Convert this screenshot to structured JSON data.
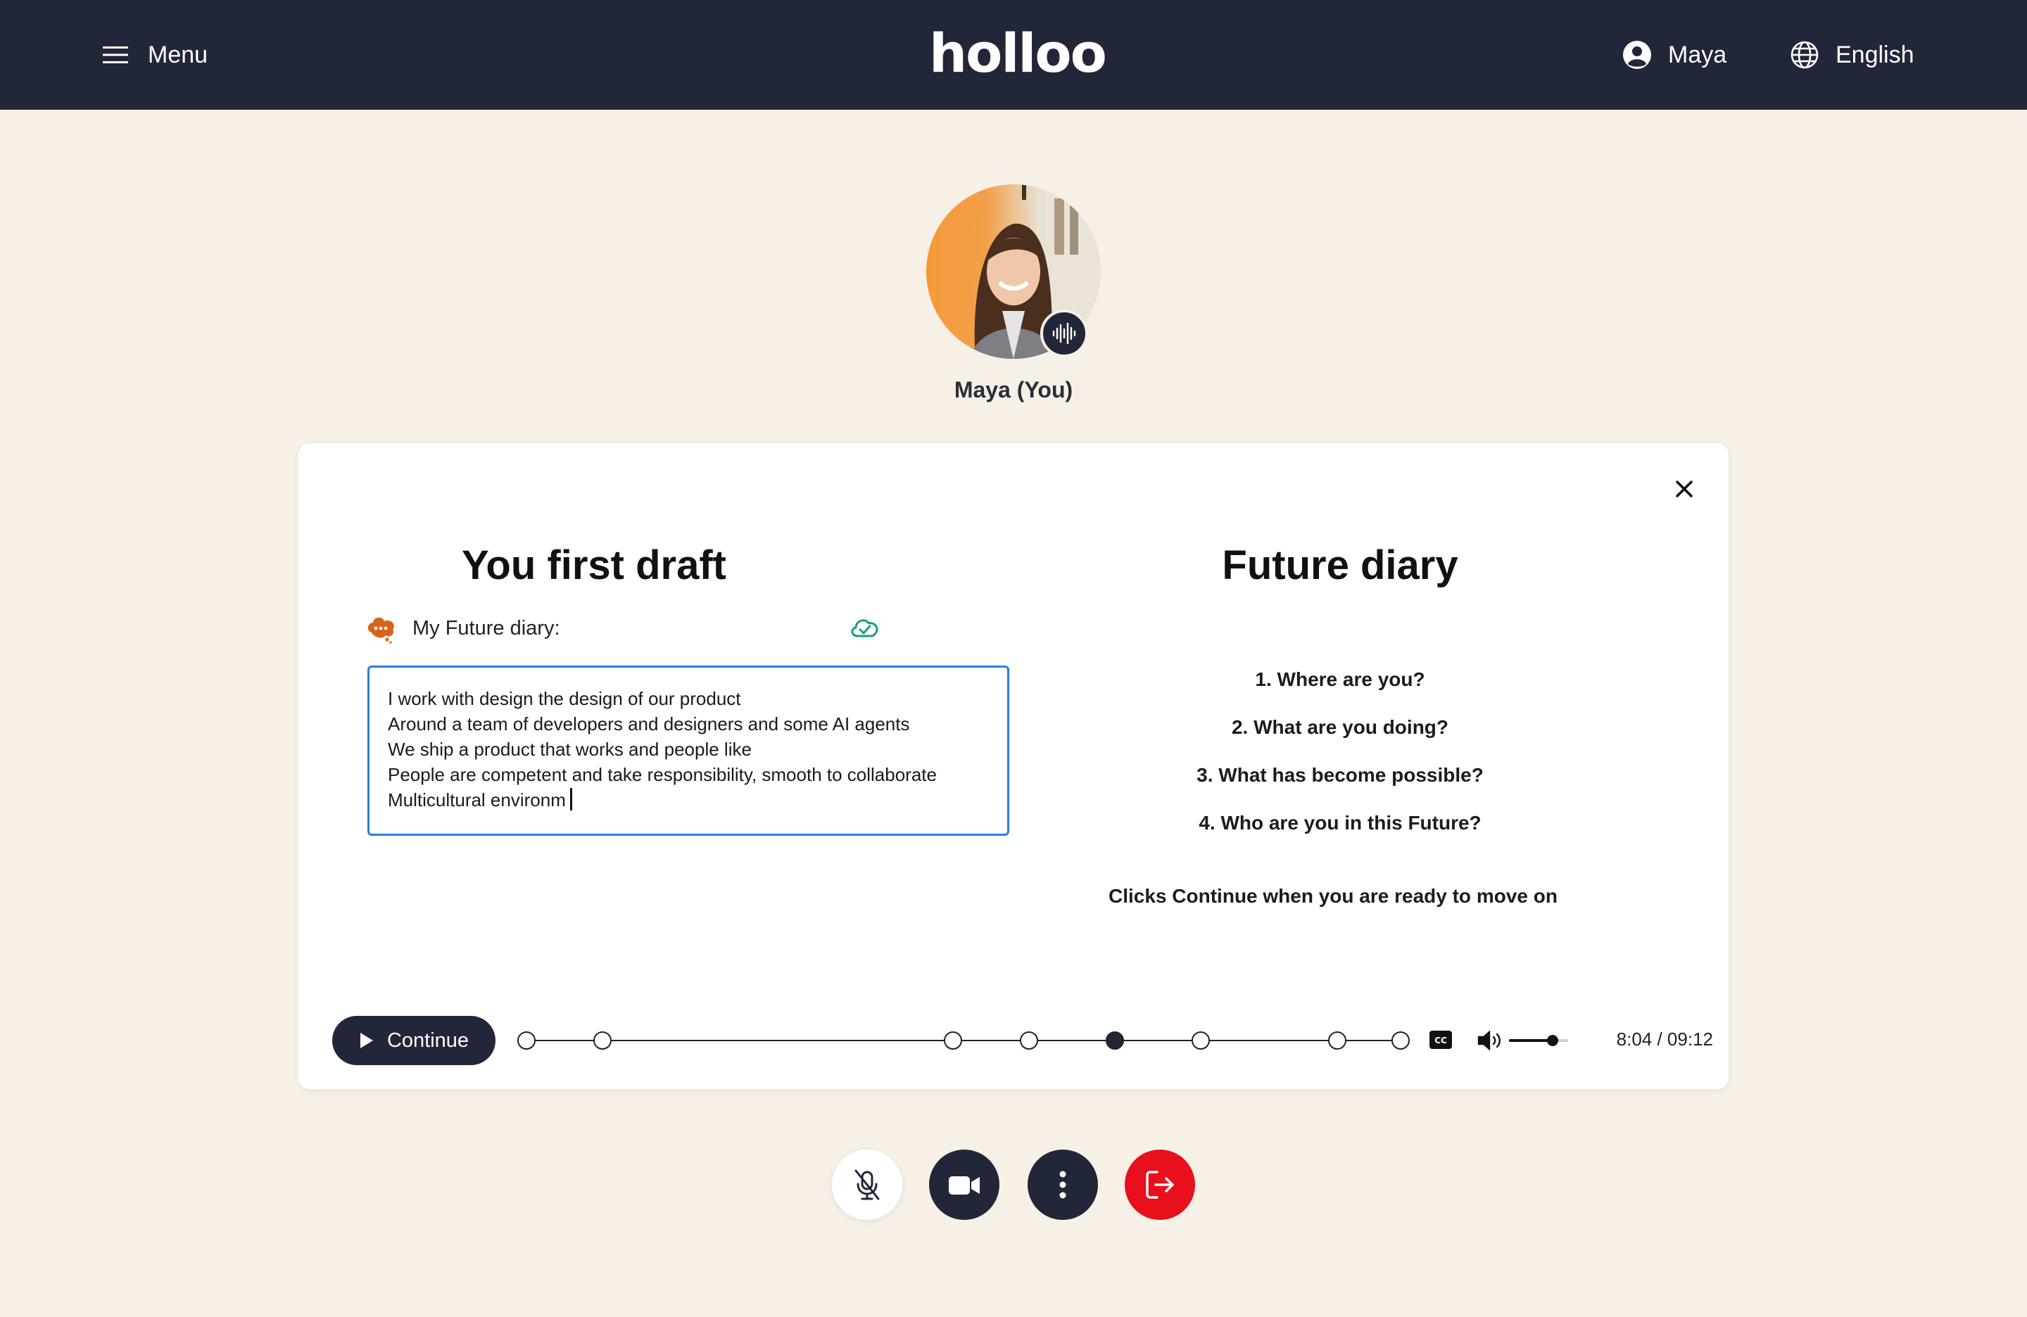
{
  "header": {
    "menu_label": "Menu",
    "logo": "holloo",
    "user_name": "Maya",
    "language": "English"
  },
  "participant": {
    "name": "Maya (You)"
  },
  "card": {
    "draft_title": "You first draft",
    "diary_label": "My Future diary:",
    "draft_lines": [
      "I work with design the design of our product",
      "Around a team of developers and designers and some AI agents",
      "We ship a product that works and people like",
      "People are competent and take responsibility, smooth to collaborate",
      "Multicultural environm"
    ],
    "diary_title": "Future diary",
    "questions": [
      "1. Where are you?",
      "2. What are you doing?",
      "3. What has become possible?",
      "4. Who are you in this Future?"
    ],
    "hint": "Clicks Continue when you are ready to move on"
  },
  "player": {
    "continue_label": "Continue",
    "time": "8:04 / 09:12",
    "progress_fraction": 0.674,
    "volume_fraction": 0.75,
    "active_marker_index": 4,
    "marker_count": 9
  },
  "colors": {
    "topbar": "#212739",
    "background": "#f7f0e6",
    "accent_blue": "#2f7ed8",
    "leave_red": "#e8101c",
    "saved_green": "#1a9e7a",
    "bubble_orange": "#d8621b"
  },
  "icons": {
    "menu": "hamburger-icon",
    "user": "user-circle-icon",
    "language": "globe-icon",
    "close": "close-icon",
    "saved": "cloud-check-icon",
    "captions": "cc-icon",
    "volume": "volume-icon",
    "mic": "mic-off-icon",
    "camera": "video-camera-icon",
    "more": "more-vertical-icon",
    "leave": "leave-icon"
  }
}
